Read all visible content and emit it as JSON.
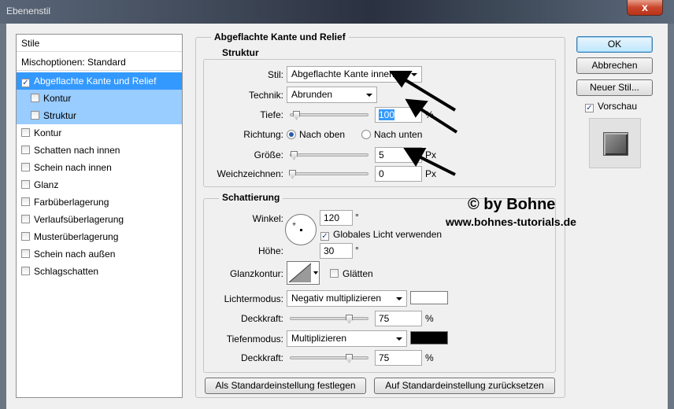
{
  "window": {
    "title": "Ebenenstil",
    "close_label": "x"
  },
  "styles_panel": {
    "header": "Stile",
    "blending": "Mischoptionen: Standard",
    "items": [
      {
        "label": "Abgeflachte Kante und Relief",
        "checked": true,
        "selected": true
      },
      {
        "label": "Kontur",
        "checked": false,
        "sub": true
      },
      {
        "label": "Struktur",
        "checked": false,
        "sub": true
      },
      {
        "label": "Kontur",
        "checked": false
      },
      {
        "label": "Schatten nach innen",
        "checked": false
      },
      {
        "label": "Schein nach innen",
        "checked": false
      },
      {
        "label": "Glanz",
        "checked": false
      },
      {
        "label": "Farbüberlagerung",
        "checked": false
      },
      {
        "label": "Verlaufsüberlagerung",
        "checked": false
      },
      {
        "label": "Musterüberlagerung",
        "checked": false
      },
      {
        "label": "Schein nach außen",
        "checked": false
      },
      {
        "label": "Schlagschatten",
        "checked": false
      }
    ]
  },
  "main": {
    "title": "Abgeflachte Kante und Relief",
    "struktur": {
      "title": "Struktur",
      "stil_label": "Stil:",
      "stil_value": "Abgeflachte Kante innen",
      "technik_label": "Technik:",
      "technik_value": "Abrunden",
      "tiefe_label": "Tiefe:",
      "tiefe_value": "100",
      "tiefe_unit": "%",
      "richtung_label": "Richtung:",
      "richtung_up": "Nach oben",
      "richtung_down": "Nach unten",
      "groesse_label": "Größe:",
      "groesse_value": "5",
      "groesse_unit": "Px",
      "weich_label": "Weichzeichnen:",
      "weich_value": "0",
      "weich_unit": "Px"
    },
    "schattierung": {
      "title": "Schattierung",
      "winkel_label": "Winkel:",
      "winkel_value": "120",
      "degree": "°",
      "global_light": "Globales Licht verwenden",
      "hoehe_label": "Höhe:",
      "hoehe_value": "30",
      "glanzkontur_label": "Glanzkontur:",
      "glaetten": "Glätten",
      "licht_label": "Lichtermodus:",
      "licht_value": "Negativ multiplizieren",
      "licht_color": "#ffffff",
      "deck1_label": "Deckkraft:",
      "deck1_value": "75",
      "tiefen_label": "Tiefenmodus:",
      "tiefen_value": "Multiplizieren",
      "tiefen_color": "#000000",
      "deck2_label": "Deckkraft:",
      "deck2_value": "75",
      "percent": "%"
    },
    "btn_default": "Als Standardeinstellung festlegen",
    "btn_reset": "Auf Standardeinstellung zurücksetzen"
  },
  "right": {
    "ok": "OK",
    "cancel": "Abbrechen",
    "new_style": "Neuer Stil...",
    "preview": "Vorschau"
  },
  "watermark": {
    "line1": "© by Bohne",
    "line2": "www.bohnes-tutorials.de"
  }
}
